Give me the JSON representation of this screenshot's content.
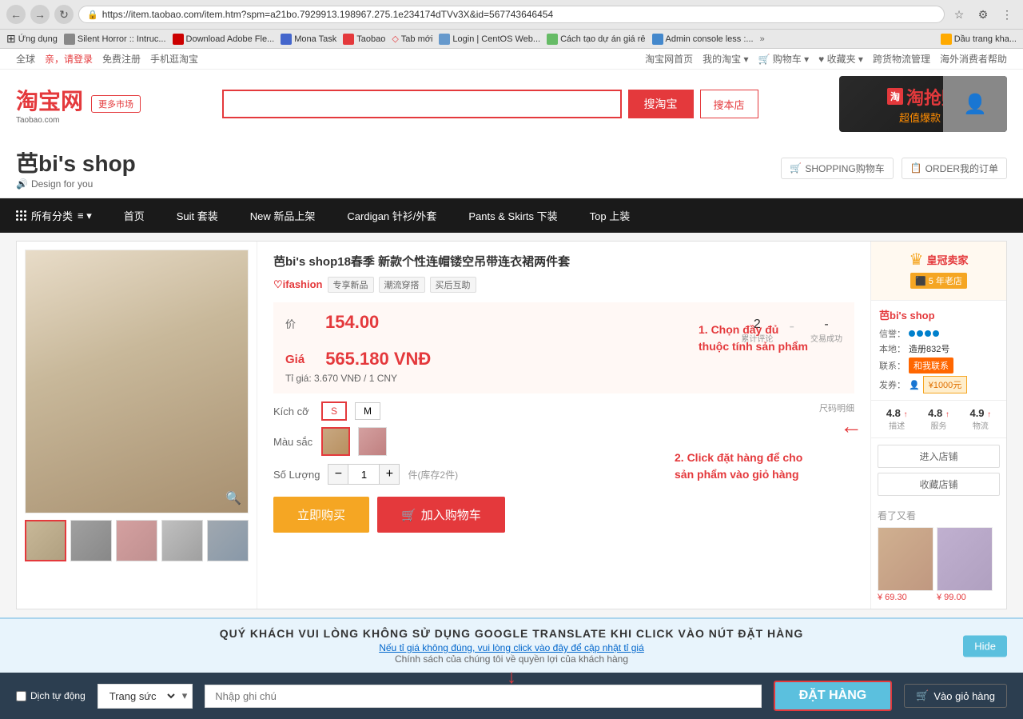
{
  "browser": {
    "url": "https://item.taobao.com/item.htm?spm=a21bo.7929913.198967.275.1e234174dTVv3X&id=567743646454",
    "back_btn": "←",
    "forward_btn": "→",
    "refresh_btn": "↻"
  },
  "bookmarks": {
    "items": [
      {
        "label": "Ứng dụng",
        "icon": "grid"
      },
      {
        "label": "Silent Horror :: Intruc...",
        "icon": "page"
      },
      {
        "label": "Download Adobe Fle...",
        "icon": "adobe"
      },
      {
        "label": "Mona Task",
        "icon": "task"
      },
      {
        "label": "Taobao",
        "icon": "taobao"
      },
      {
        "label": "Tab mới",
        "icon": "plus"
      },
      {
        "label": "Login | CentOS Web...",
        "icon": "centos"
      },
      {
        "label": "Cách tạo dự án giá rẻ",
        "icon": "idea"
      },
      {
        "label": "Admin console less :...",
        "icon": "admin"
      }
    ],
    "more_label": "»",
    "dau_trang": "Dầu trang kha..."
  },
  "top_nav": {
    "region": "全球",
    "login_prompt": "亲，请登录",
    "register": "免费注册",
    "mobile": "手机逛淘宝",
    "nav_links": [
      "淘宝网首页",
      "我的淘宝",
      "购物车",
      "收藏夹",
      "跨货物流管理",
      "海外消费者帮助"
    ]
  },
  "header": {
    "logo_text": "淘宝网",
    "logo_sub": "Taobao.com",
    "market_label": "更多市场",
    "search_placeholder": "",
    "btn_search": "搜淘宝",
    "btn_shop": "搜本店"
  },
  "shop_header": {
    "name": "芭bi's shop",
    "slogan_icon": "🔊",
    "slogan": "Design for you",
    "banner_text": "淘抢购",
    "banner_sub": "超值爆款 ›",
    "action1": "SHOPPING购物车",
    "action2": "ORDER我的订单"
  },
  "cat_nav": {
    "items": [
      {
        "label": "所有分类",
        "has_grid": true,
        "has_arrow": true
      },
      {
        "label": "首页"
      },
      {
        "label": "Suit 套装"
      },
      {
        "label": "New 新品上架"
      },
      {
        "label": "Cardigan 针衫/外套"
      },
      {
        "label": "Pants & Skirts 下装"
      },
      {
        "label": "Top 上装"
      }
    ]
  },
  "product": {
    "title": "芭bi's shop18春季 新款个性连帽镂空吊带连衣裙两件套",
    "ifashion": "♡ifashion",
    "ifashion_badges": [
      "专享新品",
      "潮流穿搭",
      "买后互助"
    ],
    "price_cny_label": "价",
    "price_cny": "154.00",
    "reviews_count": "2",
    "reviews_label": "累计评论",
    "transactions": "-",
    "transactions_label": "交易成功",
    "price_vnd_label": "Giá",
    "price_vnd": "565.180 VNĐ",
    "exchange_rate": "Tỉ giá: 3.670 VNĐ / 1 CNY",
    "size_label": "Kích cỡ",
    "sizes": [
      "S",
      "M"
    ],
    "color_label": "Màu sắc",
    "qty_label": "Số Lượng",
    "qty_value": "1",
    "qty_unit": "件(库存2件)",
    "attr_hint": "尺码明细",
    "btn_buy_now": "立即购买",
    "btn_cart_icon": "🛒",
    "btn_cart": "加入购物车",
    "annotation_1": "1. Chọn đầy đủ\nthuộc tính sản phẩm",
    "annotation_2": "2. Click đặt hàng để cho\nsản phẩm vào giỏ hàng"
  },
  "sidebar": {
    "crown_icon": "♛",
    "crown_title": "皇冠卖家",
    "years_icon": "⬛",
    "years_label": "5 年老店",
    "shop_name": "芭bi's shop",
    "info_label": "信誉：",
    "level_label": "本地：",
    "level_val": "造册832号",
    "contact_label": "联系：",
    "contact_btn": "和我联系",
    "coupon_label": "发券：",
    "coupon_icon": "👤",
    "coupon_val": "¥1000元",
    "metric1_val": "4.8",
    "metric1_arrow": "↑",
    "metric1_label": "描述",
    "metric2_val": "4.8",
    "metric2_arrow": "↑",
    "metric2_label": "服务",
    "metric3_val": "4.9",
    "metric3_arrow": "↑",
    "metric3_label": "物流",
    "btn_enter_shop": "进入店铺",
    "btn_collect_shop": "收藏店铺",
    "also_viewed_title": "看了又看",
    "also_items": [
      {
        "price": "¥ 69.30"
      },
      {
        "price": "¥ 99.00"
      }
    ]
  },
  "notify_banner": {
    "main": "QUÝ KHÁCH VUI LÒNG KHÔNG SỬ DỤNG GOOGLE TRANSLATE KHI CLICK VÀO NÚT ĐẶT HÀNG",
    "sub1": "Nếu tỉ giá không đúng, vui lòng click vào đây để cập nhật tỉ giá",
    "sub2": "Chính sách của chúng tôi về quyền lợi của khách hàng",
    "hide_btn": "Hide"
  },
  "bottom_bar": {
    "translate_label": "Dịch tự động",
    "category_options": [
      "Trang sức"
    ],
    "notes_placeholder": "Nhập ghi chú",
    "order_btn": "ĐẶT HÀNG",
    "cart_icon": "🛒",
    "cart_label": "Vào giỏ hàng"
  }
}
